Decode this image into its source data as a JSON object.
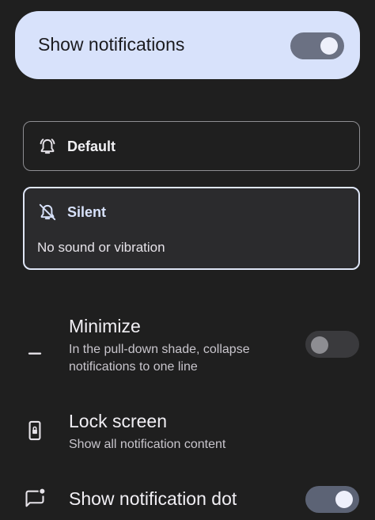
{
  "master": {
    "label": "Show notifications",
    "enabled": true
  },
  "options": {
    "default": {
      "label": "Default",
      "icon": "bell-ringing-icon"
    },
    "silent": {
      "label": "Silent",
      "description": "No sound or vibration",
      "icon": "bell-off-icon",
      "selected": true
    }
  },
  "settings": {
    "minimize": {
      "title": "Minimize",
      "description": "In the pull-down shade, collapse notifications to one line",
      "icon": "minus-icon",
      "enabled": false
    },
    "lock_screen": {
      "title": "Lock screen",
      "description": "Show all notification content",
      "icon": "lock-screen-phone-icon"
    },
    "notification_dot": {
      "title": "Show notification dot",
      "icon": "notification-dot-icon",
      "enabled": true
    }
  },
  "colors": {
    "background": "#1f1f1f",
    "accent_card": "#d8e2fb",
    "switch_on": "#5c6375",
    "switch_off": "#3a3a3d"
  }
}
